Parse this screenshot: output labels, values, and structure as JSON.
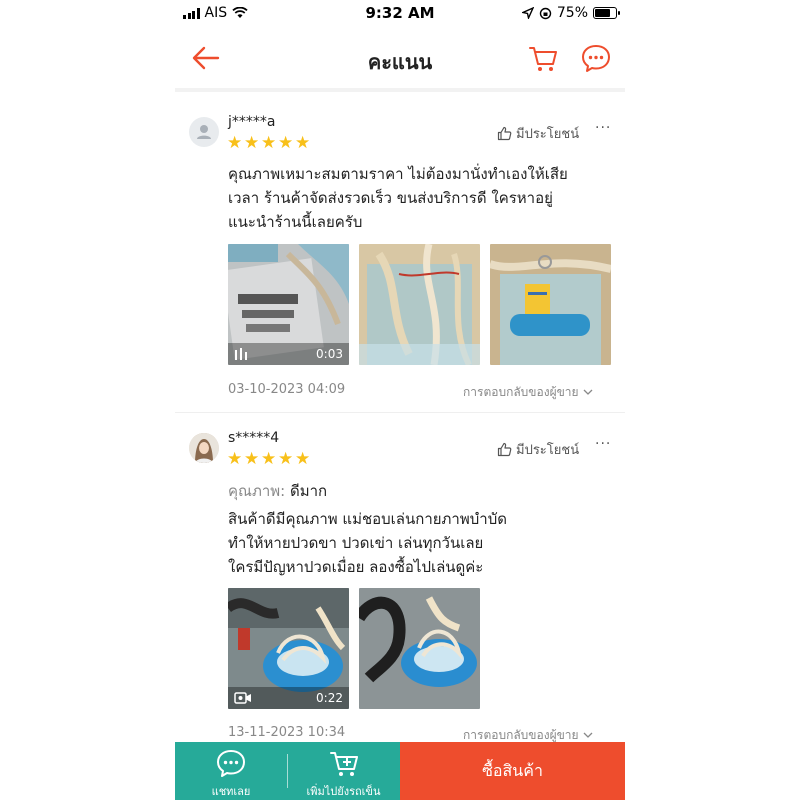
{
  "status_bar": {
    "carrier": "AIS",
    "time": "9:32 AM",
    "battery": "75%",
    "battery_level": 0.75
  },
  "header": {
    "title": "คะแนน",
    "icons": [
      "back-arrow-icon",
      "cart-icon",
      "chat-icon"
    ],
    "accent_color": "#ee4d2d"
  },
  "reviews": [
    {
      "username": "j*****a",
      "rating": 5,
      "helpful_label": "มีประโยชน์",
      "text_lines": [
        "คุณภาพเหมาะสมตามราคา ไม่ต้องมานั่งทำเองให้เสีย",
        "เวลา ร้านค้าจัดส่งรวดเร็ว  ขนส่งบริการดี ใครหาอยู่",
        "แนะนำร้านนี้เลยครับ"
      ],
      "media": [
        {
          "type": "video",
          "duration": "0:03"
        },
        {
          "type": "image"
        },
        {
          "type": "image"
        }
      ],
      "date": "03-10-2023 04:09",
      "reply_label": "การตอบกลับของผู้ขาย"
    },
    {
      "username": "s*****4",
      "rating": 5,
      "helpful_label": "มีประโยชน์",
      "quality_label": "คุณภาพ:",
      "quality_value": "ดีมาก",
      "text_lines": [
        "สินค้าดีมีคุณภาพ แม่ชอบเล่นกายภาพบำบัด",
        "ทำให้หายปวดขา ปวดเข่า เล่นทุกวันเลย",
        "ใครมีปัญหาปวดเมื่อย ลองซื้อไปเล่นดูค่ะ"
      ],
      "media": [
        {
          "type": "video",
          "duration": "0:22"
        },
        {
          "type": "image"
        }
      ],
      "date": "13-11-2023 10:34",
      "reply_label": "การตอบกลับของผู้ขาย"
    }
  ],
  "bottom_bar": {
    "chat_label": "แชทเลย",
    "add_to_cart_label": "เพิ่มไปยังรถเข็น",
    "buy_label": "ซื้อสินค้า",
    "teal_color": "#26aa99",
    "buy_color": "#ee4d2d"
  }
}
